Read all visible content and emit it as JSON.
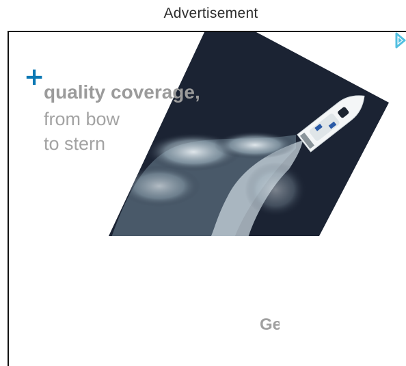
{
  "header": {
    "label": "Advertisement"
  },
  "ad": {
    "plus_symbol": "+",
    "headline": "quality coverage,",
    "subline_1": "from bow",
    "subline_2": "to stern",
    "cta_partial": "Ge",
    "image_icon": "boat-photo",
    "choices_icon": "adchoices-icon",
    "colors": {
      "water": "#1b2333",
      "accent": "#0a78b4",
      "text_gray": "#9b9b9b"
    }
  }
}
